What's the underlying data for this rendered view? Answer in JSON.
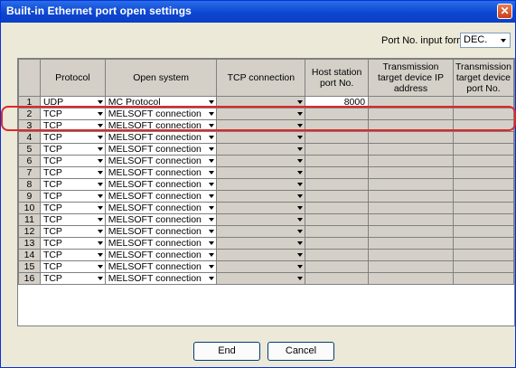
{
  "window": {
    "title": "Built-in Ethernet port open settings",
    "close_glyph": "✕"
  },
  "port_format": {
    "label": "Port No. input format",
    "value": "DEC."
  },
  "columns": {
    "num": "",
    "protocol": "Protocol",
    "open_system": "Open system",
    "tcp_connection": "TCP connection",
    "host_port": "Host station port No.",
    "target_ip": "Transmission target device IP address",
    "target_port": "Transmission target device port No."
  },
  "rows": [
    {
      "num": "1",
      "protocol": "UDP",
      "open_system": "MC Protocol",
      "host_port": "8000"
    },
    {
      "num": "2",
      "protocol": "TCP",
      "open_system": "MELSOFT connection",
      "host_port": ""
    },
    {
      "num": "3",
      "protocol": "TCP",
      "open_system": "MELSOFT connection",
      "host_port": ""
    },
    {
      "num": "4",
      "protocol": "TCP",
      "open_system": "MELSOFT connection",
      "host_port": ""
    },
    {
      "num": "5",
      "protocol": "TCP",
      "open_system": "MELSOFT connection",
      "host_port": ""
    },
    {
      "num": "6",
      "protocol": "TCP",
      "open_system": "MELSOFT connection",
      "host_port": ""
    },
    {
      "num": "7",
      "protocol": "TCP",
      "open_system": "MELSOFT connection",
      "host_port": ""
    },
    {
      "num": "8",
      "protocol": "TCP",
      "open_system": "MELSOFT connection",
      "host_port": ""
    },
    {
      "num": "9",
      "protocol": "TCP",
      "open_system": "MELSOFT connection",
      "host_port": ""
    },
    {
      "num": "10",
      "protocol": "TCP",
      "open_system": "MELSOFT connection",
      "host_port": ""
    },
    {
      "num": "11",
      "protocol": "TCP",
      "open_system": "MELSOFT connection",
      "host_port": ""
    },
    {
      "num": "12",
      "protocol": "TCP",
      "open_system": "MELSOFT connection",
      "host_port": ""
    },
    {
      "num": "13",
      "protocol": "TCP",
      "open_system": "MELSOFT connection",
      "host_port": ""
    },
    {
      "num": "14",
      "protocol": "TCP",
      "open_system": "MELSOFT connection",
      "host_port": ""
    },
    {
      "num": "15",
      "protocol": "TCP",
      "open_system": "MELSOFT connection",
      "host_port": ""
    },
    {
      "num": "16",
      "protocol": "TCP",
      "open_system": "MELSOFT connection",
      "host_port": ""
    }
  ],
  "buttons": {
    "end": "End",
    "cancel": "Cancel"
  },
  "colors": {
    "title_bar": "#0d46d1",
    "highlight": "#e0262a",
    "face": "#ece9d8"
  }
}
